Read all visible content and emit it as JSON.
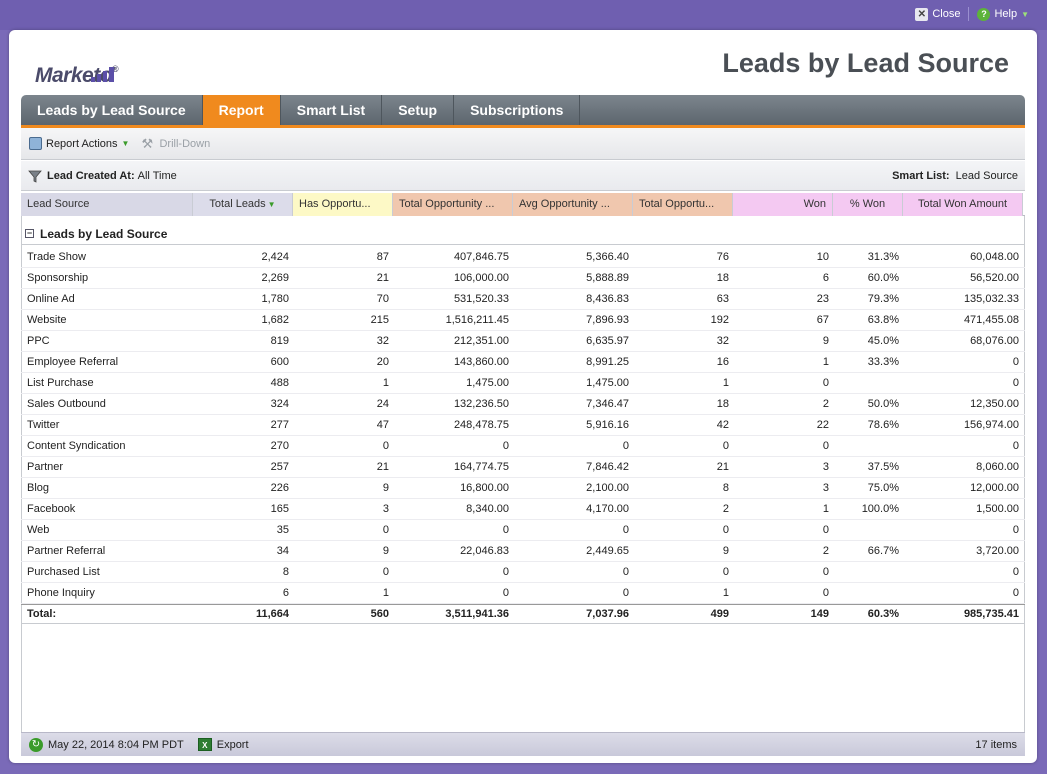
{
  "top_actions": {
    "close_label": "Close",
    "help_label": "Help"
  },
  "brand": {
    "name": "Marketo",
    "mark": "®"
  },
  "page_title": "Leads by Lead Source",
  "tabs": [
    {
      "label": "Leads by Lead Source",
      "active": false
    },
    {
      "label": "Report",
      "active": true
    },
    {
      "label": "Smart List",
      "active": false
    },
    {
      "label": "Setup",
      "active": false
    },
    {
      "label": "Subscriptions",
      "active": false
    }
  ],
  "toolbar": {
    "report_actions": "Report Actions",
    "drill_down": "Drill-Down"
  },
  "filter": {
    "left_label": "Lead Created At:",
    "left_value": "All Time",
    "right_label": "Smart List:",
    "right_value": "Lead Source"
  },
  "columns": [
    "Lead Source",
    "Total Leads",
    "Has Opportu...",
    "Total Opportunity ...",
    "Avg Opportunity ...",
    "Total Opportu...",
    "Won",
    "% Won",
    "Total Won Amount"
  ],
  "group_label": "Leads by Lead Source",
  "rows": [
    [
      "Trade Show",
      "2,424",
      "87",
      "407,846.75",
      "5,366.40",
      "76",
      "10",
      "31.3%",
      "60,048.00"
    ],
    [
      "Sponsorship",
      "2,269",
      "21",
      "106,000.00",
      "5,888.89",
      "18",
      "6",
      "60.0%",
      "56,520.00"
    ],
    [
      "Online Ad",
      "1,780",
      "70",
      "531,520.33",
      "8,436.83",
      "63",
      "23",
      "79.3%",
      "135,032.33"
    ],
    [
      "Website",
      "1,682",
      "215",
      "1,516,211.45",
      "7,896.93",
      "192",
      "67",
      "63.8%",
      "471,455.08"
    ],
    [
      "PPC",
      "819",
      "32",
      "212,351.00",
      "6,635.97",
      "32",
      "9",
      "45.0%",
      "68,076.00"
    ],
    [
      "Employee Referral",
      "600",
      "20",
      "143,860.00",
      "8,991.25",
      "16",
      "1",
      "33.3%",
      "0"
    ],
    [
      "List Purchase",
      "488",
      "1",
      "1,475.00",
      "1,475.00",
      "1",
      "0",
      "",
      "0"
    ],
    [
      "Sales Outbound",
      "324",
      "24",
      "132,236.50",
      "7,346.47",
      "18",
      "2",
      "50.0%",
      "12,350.00"
    ],
    [
      "Twitter",
      "277",
      "47",
      "248,478.75",
      "5,916.16",
      "42",
      "22",
      "78.6%",
      "156,974.00"
    ],
    [
      "Content Syndication",
      "270",
      "0",
      "0",
      "0",
      "0",
      "0",
      "",
      "0"
    ],
    [
      "Partner",
      "257",
      "21",
      "164,774.75",
      "7,846.42",
      "21",
      "3",
      "37.5%",
      "8,060.00"
    ],
    [
      "Blog",
      "226",
      "9",
      "16,800.00",
      "2,100.00",
      "8",
      "3",
      "75.0%",
      "12,000.00"
    ],
    [
      "Facebook",
      "165",
      "3",
      "8,340.00",
      "4,170.00",
      "2",
      "1",
      "100.0%",
      "1,500.00"
    ],
    [
      "Web",
      "35",
      "0",
      "0",
      "0",
      "0",
      "0",
      "",
      "0"
    ],
    [
      "Partner Referral",
      "34",
      "9",
      "22,046.83",
      "2,449.65",
      "9",
      "2",
      "66.7%",
      "3,720.00"
    ],
    [
      "Purchased List",
      "8",
      "0",
      "0",
      "0",
      "0",
      "0",
      "",
      "0"
    ],
    [
      "Phone Inquiry",
      "6",
      "1",
      "0",
      "0",
      "1",
      "0",
      "",
      "0"
    ]
  ],
  "totals": [
    "Total:",
    "11,664",
    "560",
    "3,511,941.36",
    "7,037.96",
    "499",
    "149",
    "60.3%",
    "985,735.41"
  ],
  "status": {
    "timestamp": "May 22, 2014 8:04 PM PDT",
    "export_label": "Export",
    "item_count": "17 items"
  }
}
